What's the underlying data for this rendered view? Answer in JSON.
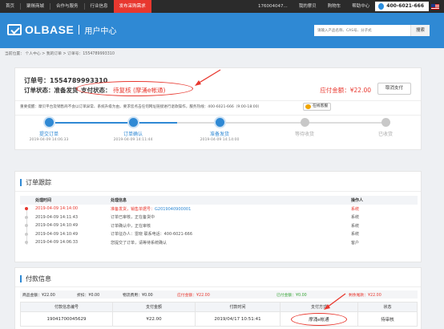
{
  "topnav": {
    "items": [
      "首页",
      "聚羰商城",
      "合作与服务",
      "行业信息",
      "发布采购需求"
    ],
    "account": "176004047...",
    "my_molbase": "我的摩贝",
    "cart": "购物车",
    "help": "帮助中心",
    "phone": "400-6021-666"
  },
  "header": {
    "logo": "OLBASE",
    "subtitle": "用户中心",
    "search_placeholder": "请输入产品名称、CAS号、分子式",
    "search_button": "搜索"
  },
  "breadcrumb": "当前位置： 个人中心 > 我的订单 > 订单号：1554789993310",
  "order": {
    "number_label": "订单号：",
    "number": "1554789993310",
    "status_label": "订单状态：",
    "status": "准备发货",
    "supplier_status_label": "支付状态：",
    "supplier_status": "待复核 (摩涌e帐通)",
    "amount": "应付金额：¥22.00",
    "cancel_button": "取消支付",
    "notice": "重要提醒：摩贝平台及销售商不会以订单异常、系统升级为由，要求您点击任何网址链接进行退款操作，服务热线：400-6021-666（9:00-18:00）",
    "chat_button": "在线客服"
  },
  "progress": {
    "steps": [
      {
        "label": "提交订单",
        "time": "2019-04-09 14:06:33",
        "state": "done"
      },
      {
        "label": "订单确认",
        "time": "2019-04-09 14:11:44",
        "state": "done"
      },
      {
        "label": "准备发货",
        "time": "2019-04-09 14:14:00",
        "state": "done"
      },
      {
        "label": "等待收货",
        "time": "",
        "state": "todo"
      },
      {
        "label": "已收货",
        "time": "",
        "state": "todo"
      }
    ],
    "colors": {
      "done": "#2f89d4",
      "todo": "#c8c8c8"
    }
  },
  "tracking": {
    "title": "订单跟踪",
    "headers": [
      "处理时间",
      "处理信息",
      "操作人"
    ],
    "rows": [
      {
        "time": "2019-04-09 14:14:00",
        "info": "准备发货，销售单据号：",
        "link": "G2019040900001",
        "operator": "系统"
      },
      {
        "time": "2019-04-09 14:11:43",
        "info": "订单已审核，正在备货中",
        "link": "",
        "operator": "系统"
      },
      {
        "time": "2019-04-09 14:10:49",
        "info": "订单确认中，正在审核",
        "link": "",
        "operator": "系统"
      },
      {
        "time": "2019-04-09 14:10:49",
        "info": "订单征办人：雷晓 联系电话：400-6021-666",
        "link": "",
        "operator": "系统"
      },
      {
        "time": "2019-04-09 14:06:33",
        "info": "您提交了订单，请等待系统确认",
        "link": "",
        "operator": "客户"
      }
    ]
  },
  "payment": {
    "title": "付款信息",
    "summary": {
      "goods": "商品金额：¥22.00",
      "discount": "折扣：¥0.00",
      "shipping": "物流费用：¥0.00",
      "payable": "应付金额：¥22.00",
      "paid": "已付金额：¥0.00",
      "unpaid": "剩余尾款：¥22.00"
    },
    "headers": [
      "付款信息编号",
      "支付金额",
      "付款时间",
      "支付方式",
      "状态"
    ],
    "row": {
      "id": "19041700045629",
      "amount": "¥22.00",
      "time": "2019/04/17 10:51:41",
      "method": "摩涌e帐通",
      "status": "待审核"
    }
  }
}
